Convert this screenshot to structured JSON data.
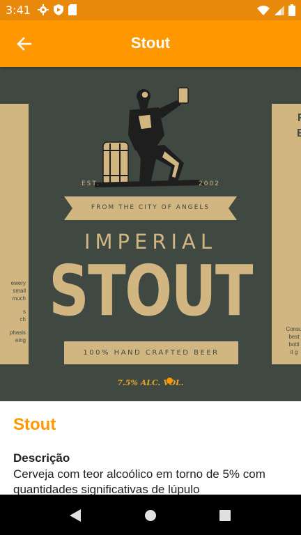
{
  "status_bar": {
    "time": "3:41",
    "left_icons": [
      "gear-icon",
      "shield-icon",
      "sd-card-icon"
    ],
    "right_icons": [
      "wifi-icon",
      "signal-icon",
      "battery-icon"
    ]
  },
  "app_bar": {
    "back_icon": "arrow-left-icon",
    "title": "Stout"
  },
  "hero_image": {
    "left_side_text": [
      "ewery",
      "small",
      "much",
      "",
      "s",
      "ch",
      "",
      "phasis",
      "eing"
    ],
    "right_side_big": [
      "F",
      "E"
    ],
    "right_side_text": [
      "Consu",
      "best",
      "bottl",
      "it g"
    ],
    "est_left": "EST.",
    "est_right": "2002",
    "banner": "FROM THE CITY OF ANGELS",
    "line1": "IMPERIAL",
    "line2": "STOUT",
    "crafted": "100% HAND CRAFTED BEER",
    "abv": "7.5% ALC. VOL."
  },
  "details": {
    "name": "Stout",
    "description_label": "Descrição",
    "description": "Cerveja com teor alcoólico em torno de 5% com quantidades significativas de lúpulo"
  },
  "colors": {
    "primary": "#ff9800",
    "status_bar": "#e8890b",
    "label_bg": "#3f4942",
    "label_tan": "#d2b682"
  },
  "nav_bar": {
    "buttons": [
      "back-triangle-icon",
      "home-circle-icon",
      "recents-square-icon"
    ]
  }
}
